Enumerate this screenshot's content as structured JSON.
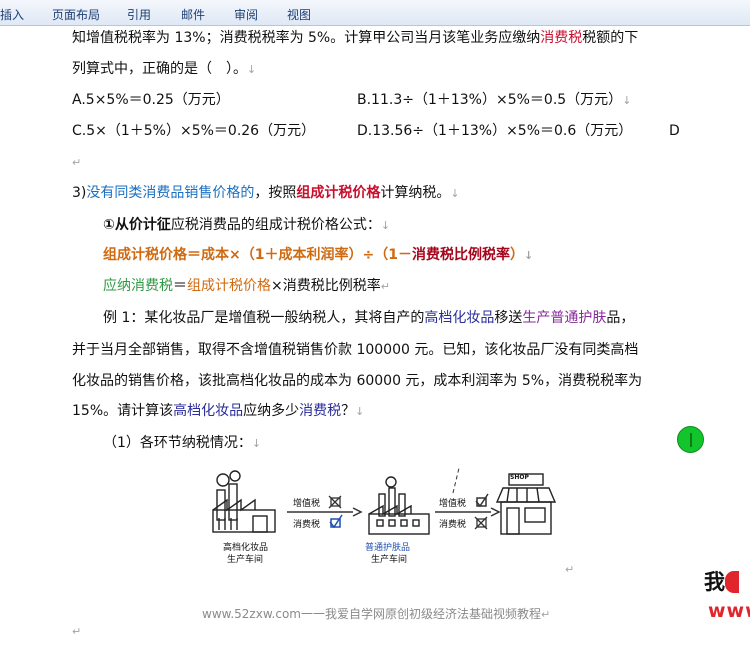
{
  "ribbon": {
    "tabs": [
      "插入",
      "页面布局",
      "引用",
      "邮件",
      "审阅",
      "视图"
    ]
  },
  "doc": {
    "line1_a": "知增值税税率为 13%；消费税税率为 5%。计算甲公司当月该笔业务应缴纳",
    "line1_hl": "消费税",
    "line1_b": "税额的下",
    "line2": "列算式中，正确的是（　）。",
    "optA": "A.5×5%＝0.25（万元）",
    "optB": "B.11.3÷（1＋13%）×5%＝0.5（万元）",
    "optC": "C.5×（1＋5%）×5%＝0.26（万元）",
    "optD": "D.13.56÷（1＋13%）×5%＝0.6（万元）",
    "optD_tail": "D",
    "sec3_num": "3)",
    "sec3_blue": "没有同类消费品销售价格的",
    "sec3_mid": "，按照",
    "sec3_red": "组成计税价格",
    "sec3_end": "计算纳税。",
    "sub1_bold": "①从价计征",
    "sub1_rest": "应税消费品的组成计税价格公式：",
    "formula1_a": "组成计税价格＝成本×（1＋成本利润率）÷（1－",
    "formula1_b": "消费税比例税率",
    "formula1_c": "）",
    "formula2_green": "应纳消费税",
    "formula2_eq": "＝",
    "formula2_orange": "组成计税价格",
    "formula2_rest": "×消费税比例税率",
    "ex_1": "例 1：某化妆品厂是增值税一般纳税人，其将自产的",
    "ex_1_hl1": "高档化妆品",
    "ex_1_mid": "移送",
    "ex_1_hl2": "生产普通护肤",
    "ex_1_end": "品，",
    "ex_2": "并于当月全部销售，取得不含增值税销售价款 100000 元。已知，该化妆品厂没有同类高档",
    "ex_3": "化妆品的销售价格，该批高档化妆品的成本为 60000 元，成本利润率为 5%，消费税税率为",
    "ex_4a": "15%。请计算该",
    "ex_4_hl": "高档化妆品",
    "ex_4b": "应纳多少",
    "ex_4_hl2": "消费税",
    "ex_4c": "？",
    "step1": "（1）各环节纳税情况：",
    "footer": "www.52zxw.com一一我爱自学网原创初级经济法基础视频教程",
    "para_mark": "↵",
    "para_mark_alt": "↓"
  },
  "figure": {
    "factory1_label1": "高档化妆品",
    "factory1_label2": "生产车间",
    "factory2_label1": "普通护肤品",
    "factory2_label2": "生产车间",
    "vat1": "增值税",
    "ct1": "消费税",
    "vat2": "增值税",
    "ct2": "消费税",
    "shop_sign": "SHOP"
  },
  "watermark": {
    "line1": "我",
    "line2": "www"
  },
  "colors": {
    "blue": "#1a6fc2",
    "red": "#c8102e",
    "orange": "#d06a10",
    "green": "#2f9a44",
    "navy": "#2b2d9a",
    "cursor": "#13c42c"
  }
}
